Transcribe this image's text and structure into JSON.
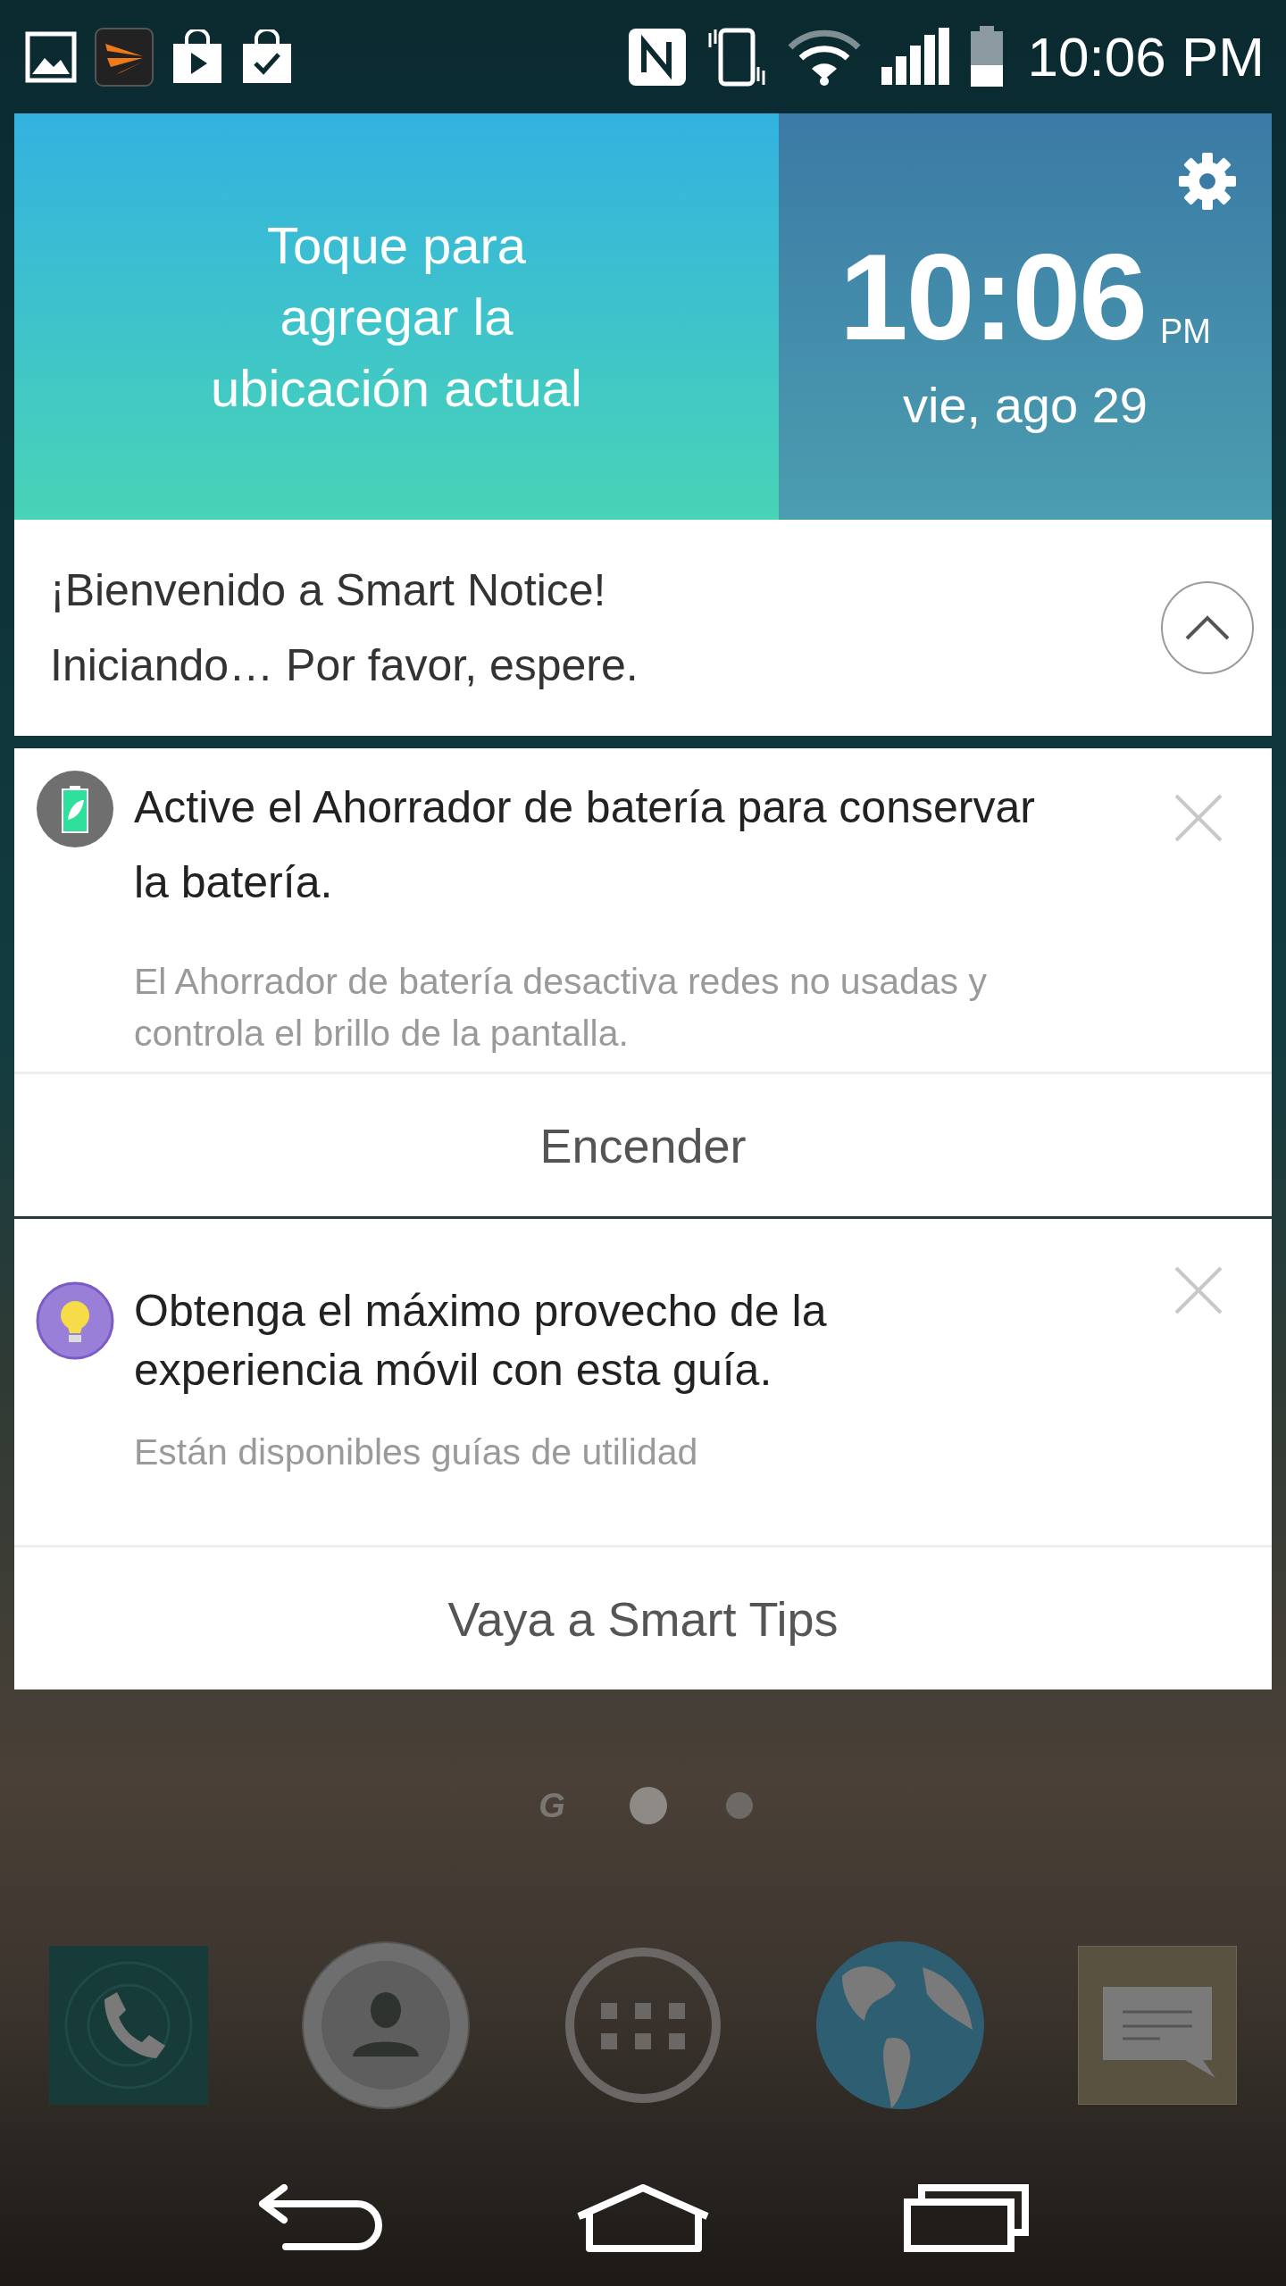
{
  "status_bar": {
    "time": "10:06 PM"
  },
  "weather_clock": {
    "location_prompt": "Toque para agregar la ubicación actual",
    "time": "10:06",
    "ampm": "PM",
    "date": "vie, ago 29"
  },
  "smart_notice": {
    "lines": [
      "¡Bienvenido a Smart Notice!",
      "Iniciando… Por favor, espere."
    ],
    "expanded": true
  },
  "notifications": [
    {
      "kind": "battery",
      "title": "Active el Ahorrador de batería para conservar la batería.",
      "body": "El Ahorrador de batería desactiva redes no usadas y controla el brillo de la pantalla.",
      "action": "Encender"
    },
    {
      "kind": "tip",
      "title": "Obtenga el máximo provecho de la experiencia móvil con esta guía.",
      "body": "Están disponibles guías de utilidad",
      "action": "Vaya a Smart Tips"
    }
  ],
  "page_indicators": [
    {
      "kind": "logo",
      "label": "G",
      "selected": false
    },
    {
      "kind": "dot",
      "selected": true
    },
    {
      "kind": "dot",
      "selected": false
    }
  ]
}
